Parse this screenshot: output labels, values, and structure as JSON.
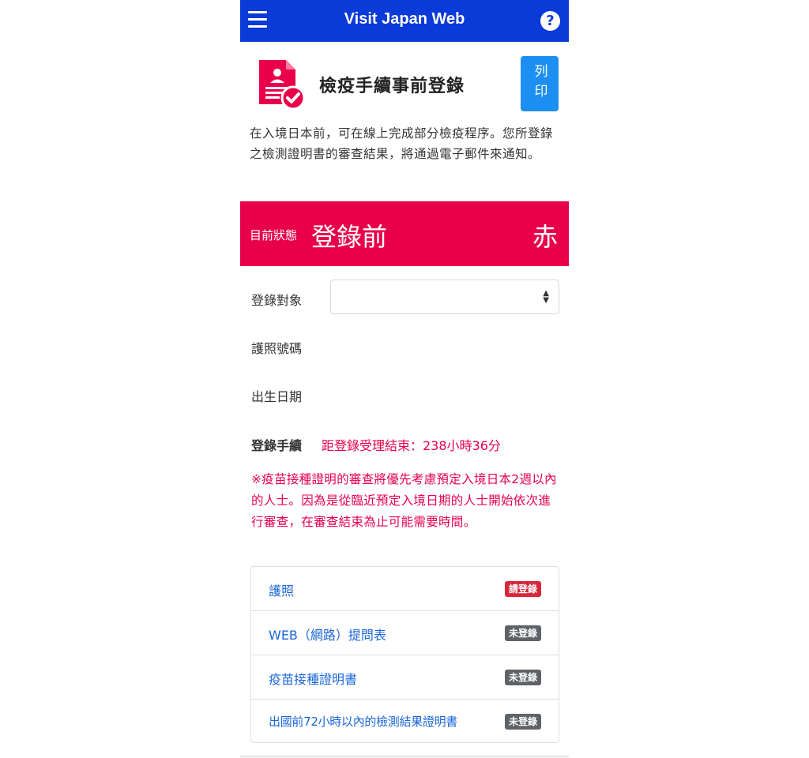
{
  "header": {
    "app_title": "Visit Japan Web",
    "help_icon": "?"
  },
  "page": {
    "title": "檢疫手續事前登錄",
    "print_label": "列印",
    "intro": "在入境日本前，可在線上完成部分檢疫程序。您所登錄之檢測證明書的審查結果，將通過電子郵件來通知。"
  },
  "status": {
    "label": "目前狀態",
    "value": "登錄前",
    "color_label": "赤",
    "bg_color": "#e8004b"
  },
  "form": {
    "target_label": "登錄對象",
    "target_value": "",
    "passport_label": "護照號碼",
    "birth_label": "出生日期"
  },
  "procedure": {
    "label": "登錄手續",
    "deadline": "距登錄受理結束：238小時36分",
    "notice": "※疫苗接種證明的審查將優先考慮預定入境日本2週以內的人士。因為是從臨近預定入境日期的人士開始依次進行審查，在審查結束為止可能需要時間。"
  },
  "documents": [
    {
      "name": "護照",
      "status": "請登錄",
      "status_color": "#d9263b"
    },
    {
      "name": "WEB（網路）提問表",
      "status": "未登錄",
      "status_color": "#5f6368"
    },
    {
      "name": "疫苗接種證明書",
      "status": "未登錄",
      "status_color": "#5f6368"
    },
    {
      "name": "出國前72小時以內的檢測結果證明書",
      "status": "未登錄",
      "status_color": "#5f6368"
    }
  ]
}
